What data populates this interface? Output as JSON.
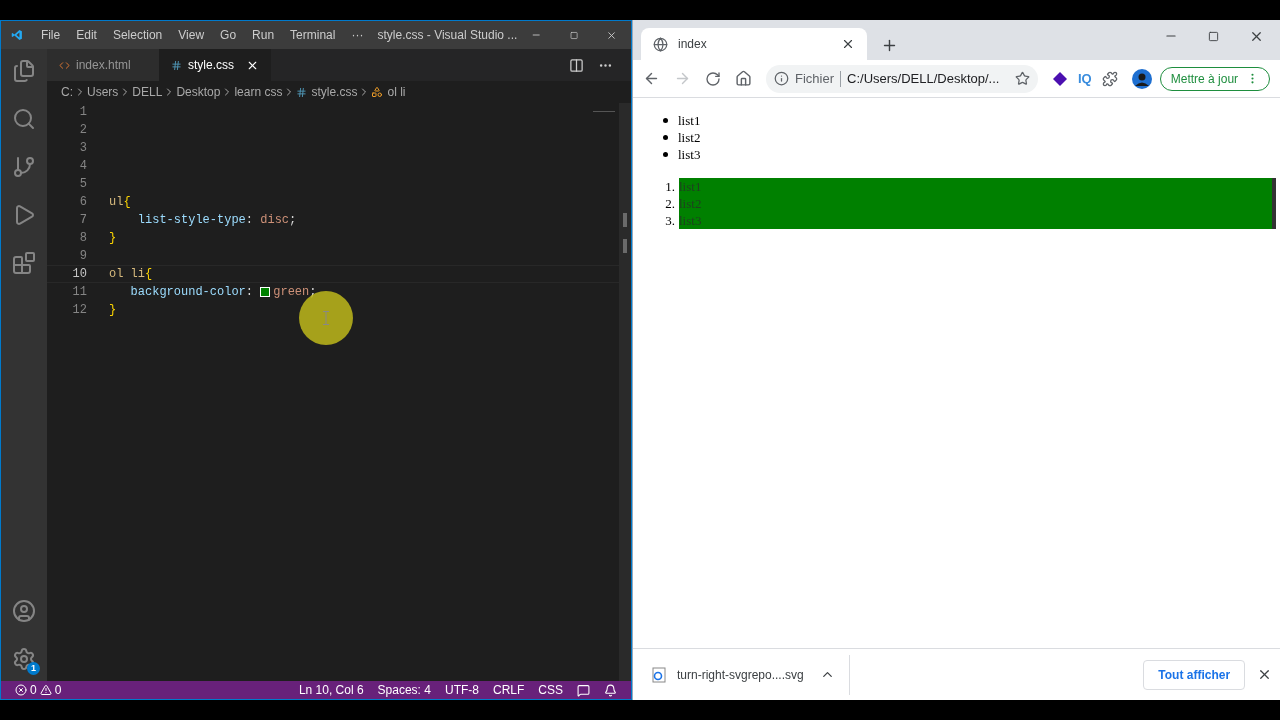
{
  "vscode": {
    "menu": [
      "File",
      "Edit",
      "Selection",
      "View",
      "Go",
      "Run",
      "Terminal",
      "···"
    ],
    "title": "style.css - Visual Studio ...",
    "tabs": [
      {
        "label": "index.html",
        "kind": "html",
        "selected": false
      },
      {
        "label": "style.css",
        "kind": "css",
        "selected": true
      }
    ],
    "breadcrumb": [
      {
        "label": "C:",
        "kind": "folder"
      },
      {
        "label": "Users",
        "kind": "folder"
      },
      {
        "label": "DELL",
        "kind": "folder"
      },
      {
        "label": "Desktop",
        "kind": "folder"
      },
      {
        "label": "learn css",
        "kind": "folder"
      },
      {
        "label": "style.css",
        "kind": "css"
      },
      {
        "label": "ol li",
        "kind": "symbol"
      }
    ],
    "lines": [
      {
        "number": "1",
        "current": false
      },
      {
        "number": "2",
        "current": false
      },
      {
        "number": "3",
        "current": false
      },
      {
        "number": "4",
        "current": false
      },
      {
        "number": "5",
        "current": false
      },
      {
        "number": "6",
        "current": false,
        "tokens": [
          {
            "text": "ul",
            "kind": "selector"
          },
          {
            "text": "{",
            "kind": "brace"
          }
        ]
      },
      {
        "number": "7",
        "current": false,
        "tokens": [
          {
            "text": "    list-style-type",
            "kind": "property"
          },
          {
            "text": ": ",
            "kind": "punct"
          },
          {
            "text": "disc",
            "kind": "value"
          },
          {
            "text": ";",
            "kind": "punct"
          }
        ]
      },
      {
        "number": "8",
        "current": false,
        "tokens": [
          {
            "text": "}",
            "kind": "brace"
          }
        ]
      },
      {
        "number": "9",
        "current": false
      },
      {
        "number": "10",
        "current": true,
        "tokens": [
          {
            "text": "ol li",
            "kind": "selector"
          },
          {
            "text": "{",
            "kind": "brace"
          }
        ]
      },
      {
        "number": "11",
        "current": false,
        "tokens": [
          {
            "text": "   background-color",
            "kind": "property"
          },
          {
            "text": ": ",
            "kind": "punct"
          },
          {
            "kind": "swatch",
            "color": "#008000"
          },
          {
            "text": "green",
            "kind": "value"
          },
          {
            "text": ";",
            "kind": "punct"
          }
        ]
      },
      {
        "number": "12",
        "current": false,
        "tokens": [
          {
            "text": "}",
            "kind": "brace"
          }
        ]
      }
    ],
    "status_bar": {
      "errors": "0",
      "warnings": "0",
      "items": [
        "Ln 10, Col 6",
        "Spaces: 4",
        "UTF-8",
        "CRLF",
        "CSS"
      ]
    },
    "settings_badge": "1"
  },
  "browser": {
    "tab": {
      "title": "index"
    },
    "toolbar": {
      "forward_disabled": true,
      "scheme": "Fichier",
      "url": "C:/Users/DELL/Desktop/...",
      "extension_label": "IQ",
      "update_button": "Mettre à jour"
    },
    "page": {
      "unordered": [
        "list1",
        "list2",
        "list3"
      ],
      "ordered": [
        {
          "marker": "1.",
          "text": "list1",
          "color": "#008000"
        },
        {
          "marker": "2.",
          "text": "list2",
          "color": "#008000"
        },
        {
          "marker": "3.",
          "text": "list3",
          "color": "#008000"
        }
      ]
    },
    "download_bar": {
      "file": "turn-right-svgrepo....svg",
      "show_all": "Tout afficher"
    }
  }
}
